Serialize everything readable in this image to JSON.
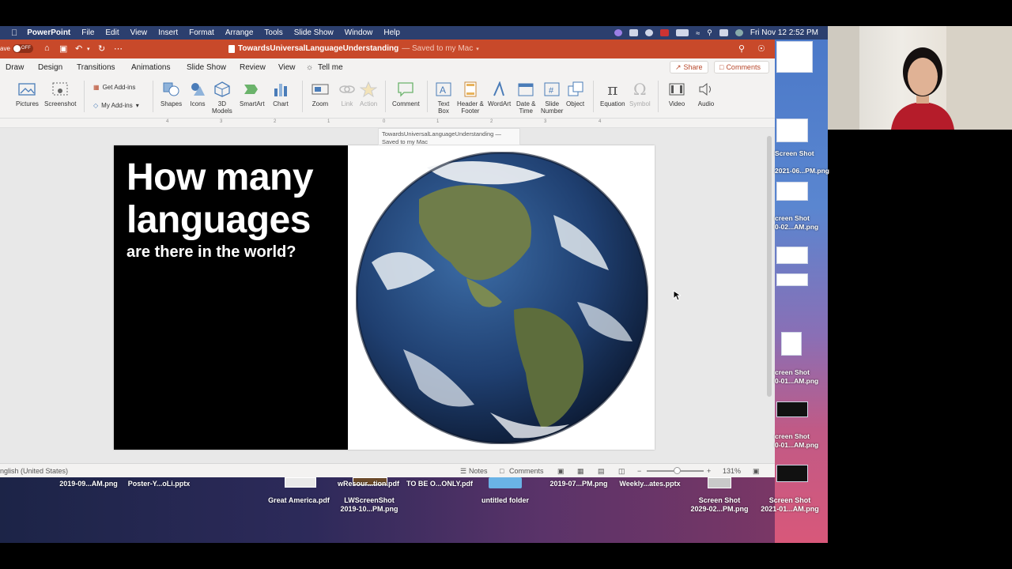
{
  "menubar": {
    "app": "PowerPoint",
    "items": [
      "File",
      "Edit",
      "View",
      "Insert",
      "Format",
      "Arrange",
      "Tools",
      "Slide Show",
      "Window",
      "Help"
    ],
    "clock": "Fri Nov 12  2:52 PM"
  },
  "titlebar": {
    "autosave_label": "ave",
    "autosave_state": "OFF",
    "doc_name": "TowardsUniversalLanguageUnderstanding",
    "doc_status": "— Saved to my Mac"
  },
  "tabs": {
    "items": [
      "Draw",
      "Design",
      "Transitions",
      "Animations",
      "Slide Show",
      "Review",
      "View"
    ],
    "tell_me": "Tell me",
    "share": "Share",
    "comments": "Comments"
  },
  "ribbon": {
    "pictures": "Pictures",
    "screenshot": "Screenshot",
    "get_addins": "Get Add-ins",
    "my_addins": "My Add-ins",
    "shapes": "Shapes",
    "icons": "Icons",
    "models": "3D\nModels",
    "smartart": "SmartArt",
    "chart": "Chart",
    "zoom": "Zoom",
    "link": "Link",
    "action": "Action",
    "comment": "Comment",
    "textbox": "Text\nBox",
    "header_footer": "Header &\nFooter",
    "wordart": "WordArt",
    "date_time": "Date &\nTime",
    "slide_number": "Slide\nNumber",
    "object": "Object",
    "equation": "Equation",
    "symbol": "Symbol",
    "video": "Video",
    "audio": "Audio"
  },
  "ruler": {
    "labels": [
      "4",
      "3",
      "2",
      "1",
      "0",
      "1",
      "2",
      "3",
      "4"
    ]
  },
  "tooltip": "TowardsUniversalLanguageUnderstanding — Saved to my Mac",
  "slide": {
    "title_line1": "How many",
    "title_line2": "languages",
    "subtitle": "are there in the world?"
  },
  "statusbar": {
    "language": "nglish (United States)",
    "notes": "Notes",
    "comments": "Comments",
    "zoom": "131%"
  },
  "desktop_files": {
    "f1": "2019-09...AM.png",
    "f2": "Poster-Y...oLi.pptx",
    "f3": "Great America.pdf",
    "f4a": "LWScreenShot",
    "f4b": "2019-10...PM.png",
    "f5": "untitled folder",
    "f6": "2019-07...PM.png",
    "f7": "Weekly...ates.pptx",
    "f8a": "Screen Shot",
    "f8b": "2029-02...PM.png",
    "f9a": "Screen Shot",
    "f9b": "2021-01...AM.png",
    "f10": "wResour...tion.pdf",
    "f11": "TO BE O...ONLY.pdf"
  },
  "right_strip": {
    "l1": "Screen Shot",
    "l2": "2021-06...PM.png",
    "l3": "creen Shot",
    "l4": "0-02...AM.png",
    "l5": "creen Shot",
    "l6": "0-01...AM.png",
    "l7": "creen Shot",
    "l8": "0-01...AM.png"
  },
  "colors": {
    "ppt_orange": "#c8492a",
    "accent": "#b7472a"
  }
}
